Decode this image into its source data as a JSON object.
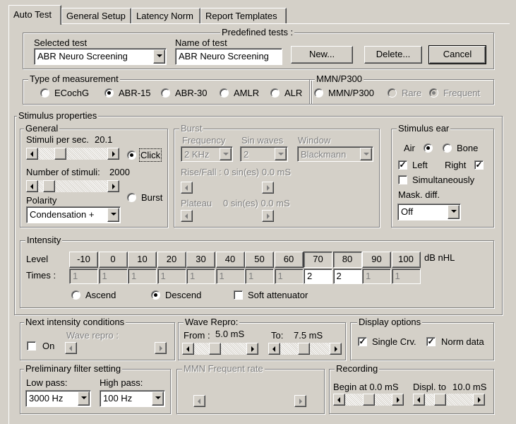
{
  "tabs": [
    "Auto Test",
    "General Setup",
    "Latency Norm",
    "Report Templates"
  ],
  "predefined": {
    "title": "Predefined tests :",
    "selected_test_label": "Selected test",
    "selected_test_value": "ABR Neuro Screening",
    "name_label": "Name of test",
    "name_value": "ABR Neuro Screening",
    "new_btn": "New...",
    "delete_btn": "Delete...",
    "cancel_btn": "Cancel"
  },
  "measurement": {
    "title": "Type of measurement",
    "options": [
      "ECochG",
      "ABR-15",
      "ABR-30",
      "AMLR",
      "ALR"
    ],
    "selected": "ABR-15"
  },
  "mmn": {
    "title": "MMN/P300",
    "options": [
      "MMN/P300",
      "Rare",
      "Frequent"
    ],
    "selected": "Frequent"
  },
  "stimulus": {
    "title": "Stimulus properties",
    "general": {
      "title": "General",
      "rate_label": "Stimuli per sec.",
      "rate_value": "20.1",
      "count_label": "Number of stimuli:",
      "count_value": "2000",
      "polarity_label": "Polarity",
      "polarity_value": "Condensation +",
      "click_label": "Click",
      "burst_label": "Burst",
      "type_selected": "Click"
    },
    "burst": {
      "title": "Burst",
      "frequency_label": "Frequency",
      "frequency_value": "2 KHz",
      "sin_label": "Sin waves",
      "sin_value": "2",
      "window_label": "Window",
      "window_value": "Blackmann",
      "risefall_text": "Rise/Fall : 0 sin(es) 0.0 mS",
      "plateau_label": "Plateau",
      "plateau_text": "0 sin(es) 0.0 mS"
    },
    "ear": {
      "title": "Stimulus ear",
      "air_label": "Air",
      "bone_label": "Bone",
      "conduction_selected": "Air",
      "left_label": "Left",
      "right_label": "Right",
      "left_checked": true,
      "right_checked": true,
      "simultaneous_label": "Simultaneously",
      "simultaneous_checked": false,
      "mask_label": "Mask. diff.",
      "mask_value": "Off"
    }
  },
  "intensity": {
    "title": "Intensity",
    "level_label": "Level",
    "times_label": "Times :",
    "unit": "dB nHL",
    "levels": [
      "-10",
      "0",
      "10",
      "20",
      "30",
      "40",
      "50",
      "60",
      "70",
      "80",
      "90",
      "100"
    ],
    "active_levels": [
      "70",
      "80"
    ],
    "times": [
      "1",
      "1",
      "1",
      "1",
      "1",
      "1",
      "1",
      "1",
      "2",
      "2",
      "1",
      "1"
    ],
    "ascend_label": "Ascend",
    "descend_label": "Descend",
    "order_selected": "Descend",
    "soft_label": "Soft attenuator",
    "soft_checked": false
  },
  "next_intensity": {
    "title": "Next intensity conditions",
    "on_label": "On",
    "on_checked": false,
    "wave_repro_label": "Wave repro :"
  },
  "wave_repro": {
    "title": "Wave Repro:",
    "from_label": "From :",
    "from_value": "5.0 mS",
    "to_label": "To:",
    "to_value": "7.5 mS"
  },
  "display": {
    "title": "Display options",
    "single_label": "Single Crv.",
    "single_checked": true,
    "norm_label": "Norm data",
    "norm_checked": true
  },
  "filter": {
    "title": "Preliminary filter setting",
    "low_label": "Low pass:",
    "low_value": "3000 Hz",
    "high_label": "High pass:",
    "high_value": "100 Hz"
  },
  "mmn_rate": {
    "title": "MMN Frequent rate"
  },
  "recording": {
    "title": "Recording",
    "begin_label": "Begin at 0.0 mS",
    "displ_label": "Displ. to",
    "displ_value": "10.0 mS"
  }
}
